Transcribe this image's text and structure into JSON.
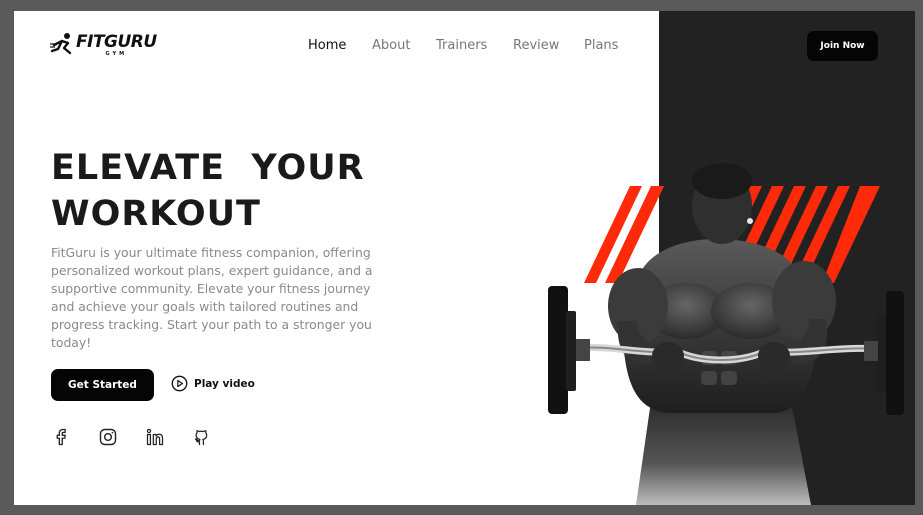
{
  "brand": {
    "name": "FITGURU",
    "sub": "GYM"
  },
  "nav": {
    "items": [
      {
        "label": "Home",
        "active": true
      },
      {
        "label": "About",
        "active": false
      },
      {
        "label": "Trainers",
        "active": false
      },
      {
        "label": "Review",
        "active": false
      },
      {
        "label": "Plans",
        "active": false
      }
    ]
  },
  "header": {
    "join_label": "Join Now"
  },
  "hero": {
    "title_line1": "ELEVATE  YOUR",
    "title_line2": "WORKOUT",
    "description": "FitGuru is your ultimate fitness companion, offering personalized workout plans, expert guidance, and a supportive community. Elevate your fitness journey and achieve your goals with tailored routines and progress tracking. Start your path to a stronger you today!",
    "cta_label": "Get Started",
    "play_label": "Play video"
  },
  "socials": [
    "facebook-icon",
    "instagram-icon",
    "linkedin-icon",
    "github-icon"
  ],
  "colors": {
    "accent": "#ff2a0a",
    "dark": "#222222",
    "button": "#050505",
    "text_muted": "#8a8a8a",
    "backdrop": "#5a5a5a"
  }
}
